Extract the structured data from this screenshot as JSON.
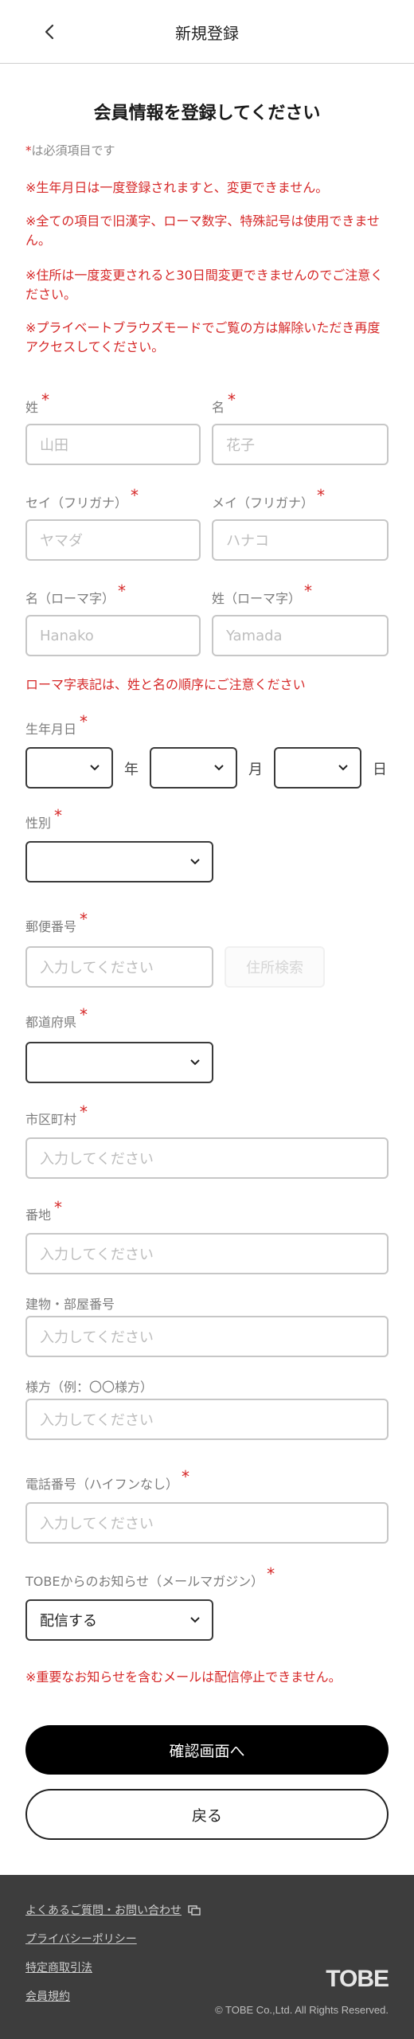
{
  "header": {
    "title": "新規登録",
    "back_icon": "chevron-left-icon"
  },
  "page": {
    "title": "会員情報を登録してください",
    "required_mark": "*",
    "required_note": "は必須項目です"
  },
  "notices": [
    "※生年月日は一度登録されますと、変更できません。",
    "※全ての項目で旧漢字、ローマ数字、特殊記号は使用できません。",
    "※住所は一度変更されると30日間変更できませんのでご注意ください。",
    "※プライベートブラウズモードでご覧の方は解除いただき再度アクセスしてください。"
  ],
  "form": {
    "last_name": {
      "label": "姓",
      "placeholder": "山田"
    },
    "first_name": {
      "label": "名",
      "placeholder": "花子"
    },
    "last_kana": {
      "label": "セイ（フリガナ）",
      "placeholder": "ヤマダ"
    },
    "first_kana": {
      "label": "メイ（フリガナ）",
      "placeholder": "ハナコ"
    },
    "first_roman": {
      "label": "名（ローマ字）",
      "placeholder": "Hanako"
    },
    "last_roman": {
      "label": "姓（ローマ字）",
      "placeholder": "Yamada"
    },
    "roman_note": "ローマ字表記は、姓と名の順序にご注意ください",
    "birthday": {
      "label": "生年月日",
      "year_unit": "年",
      "month_unit": "月",
      "day_unit": "日",
      "year_value": "",
      "month_value": "",
      "day_value": ""
    },
    "gender": {
      "label": "性別",
      "value": ""
    },
    "postal": {
      "label": "郵便番号",
      "placeholder": "入力してください",
      "search_label": "住所検索"
    },
    "prefecture": {
      "label": "都道府県",
      "value": ""
    },
    "city": {
      "label": "市区町村",
      "placeholder": "入力してください"
    },
    "address": {
      "label": "番地",
      "placeholder": "入力してください"
    },
    "building": {
      "label": "建物・部屋番号",
      "placeholder": "入力してください"
    },
    "care_of": {
      "label": "様方（例：〇〇様方）",
      "placeholder": "入力してください"
    },
    "phone": {
      "label": "電話番号（ハイフンなし）",
      "placeholder": "入力してください"
    },
    "newsletter": {
      "label": "TOBEからのお知らせ（メールマガジン）",
      "value": "配信する"
    },
    "newsletter_note": "※重要なお知らせを含むメールは配信停止できません。"
  },
  "actions": {
    "confirm_label": "確認画面へ",
    "back_label": "戻る"
  },
  "footer": {
    "links": [
      "よくあるご質問・お問い合わせ",
      "プライバシーポリシー",
      "特定商取引法",
      "会員規約"
    ],
    "logo": "TOBE",
    "copyright": "© TOBE Co.,Ltd. All Rights Reserved."
  }
}
